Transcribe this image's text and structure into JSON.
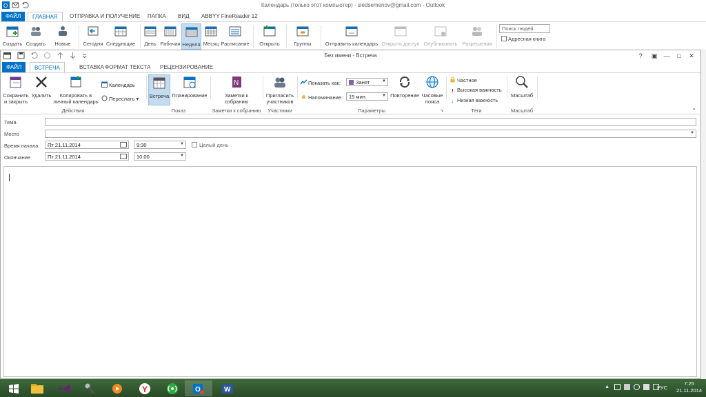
{
  "background_window": {
    "title": "Календарь (только этот компьютер) - sledsemenov@gmail.com - Outlook",
    "tabs": [
      "ФАЙЛ",
      "ГЛАВНАЯ",
      "ОТПРАВКА И ПОЛУЧЕНИЕ",
      "ПАПКА",
      "ВИД",
      "ABBYY FineReader 12"
    ],
    "ribbon": {
      "create1": "Создать",
      "create2": "Создать",
      "new": "Новые",
      "today": "Сегодня",
      "next": "Следующие",
      "day": "День",
      "work": "Рабочая",
      "week": "Неделя",
      "month": "Месяц",
      "schedule": "Расписание",
      "open": "Открыть",
      "groups": "Группы",
      "send_calendar": "Отправить календарь",
      "open_access": "Открыть доступ",
      "publish": "Опубликовать",
      "permissions": "Разрешения",
      "people_search": "Поиск людей",
      "address_book": "Адресная книга"
    }
  },
  "meeting_window": {
    "title": "Без имени - Встреча",
    "controls": {
      "help": "?",
      "restore": "▣",
      "minimize": "—",
      "maximize": "□",
      "close": "✕"
    },
    "tabs": [
      "ФАЙЛ",
      "ВСТРЕЧА",
      "ВСТАВКА",
      "ФОРМАТ ТЕКСТА",
      "РЕЦЕНЗИРОВАНИЕ"
    ],
    "ribbon": {
      "save_close_1": "Сохранить",
      "save_close_2": "и закрыть",
      "delete": "Удалить",
      "copy_cal_1": "Копировать в",
      "copy_cal_2": "личный календарь",
      "calendar": "Календарь",
      "forward": "Переслать",
      "group_actions": "Действия",
      "meeting": "Встреча",
      "planning": "Планирование",
      "group_show": "Показ",
      "notes_1": "Заметки к",
      "notes_2": "собранию",
      "group_notes": "Заметки к собранию",
      "invite_1": "Пригласить",
      "invite_2": "участников",
      "group_participants": "Участники",
      "show_as_label": "Показать как:",
      "show_as_value": "Занят",
      "reminder_label": "Напоминание:",
      "reminder_value": "15 мин.",
      "recurrence": "Повторение",
      "timezones_1": "Часовые",
      "timezones_2": "пояса",
      "group_params": "Параметры",
      "private": "Частное",
      "high_importance": "Высокая важность",
      "low_importance": "Низкая важность",
      "group_tags": "Теги",
      "zoom": "Масштаб",
      "group_zoom": "Масштаб"
    },
    "form": {
      "subject_label": "Тема",
      "subject_value": "",
      "location_label": "Место",
      "location_value": "",
      "start_label": "Время начала",
      "start_date": "Пт 21.11.2014",
      "start_time": "9:30",
      "allday_label": "Целый день",
      "allday_checked": false,
      "end_label": "Окончание",
      "end_date": "Пт 21.11.2014",
      "end_time": "10:00"
    }
  },
  "taskbar": {
    "lang": "РУС",
    "time": "7:25",
    "date": "21.11.2014"
  },
  "colors": {
    "accent": "#0072c6",
    "taskbar": "#2f552e"
  }
}
